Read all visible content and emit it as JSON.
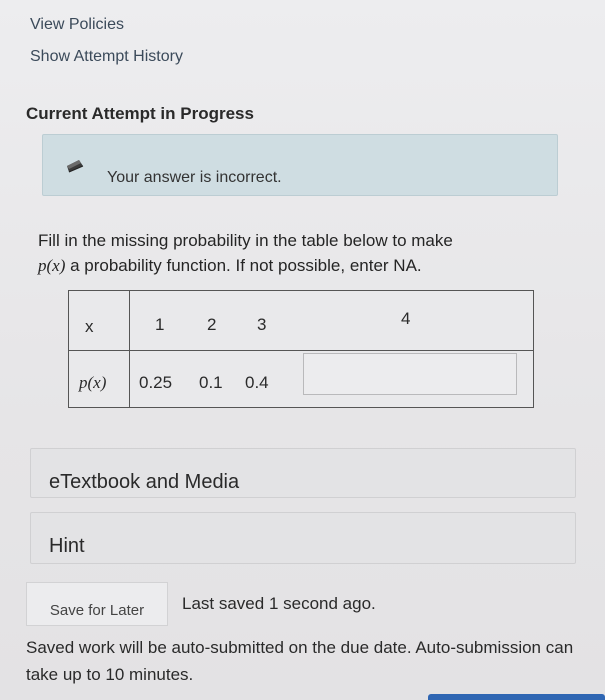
{
  "links": {
    "view_policies": "View Policies",
    "show_attempt_history": "Show Attempt History"
  },
  "attempt": {
    "title": "Current Attempt in Progress"
  },
  "feedback": {
    "icon": "pencil-icon",
    "message": "Your answer is incorrect."
  },
  "question": {
    "line1": "Fill in the missing probability in the table below to make",
    "math_px": "p(x)",
    "line2_rest": " a probability function. If not possible, enter NA."
  },
  "table": {
    "row1_header": "x",
    "row2_header": "p(x)",
    "x_values": [
      "1",
      "2",
      "3",
      "4"
    ],
    "p_values": [
      "0.25",
      "0.1",
      "0.4"
    ],
    "answer_value": ""
  },
  "resources": {
    "etextbook_label": "eTextbook and Media",
    "hint_label": "Hint"
  },
  "footer": {
    "save_label": "Save for Later",
    "last_saved": "Last saved 1 second ago.",
    "auto_submit_note": "Saved work will be auto-submitted on the due date. Auto-submission can take up to 10 minutes."
  },
  "colors": {
    "alert_bg": "#cfdde2",
    "accent": "#2f66b3"
  }
}
